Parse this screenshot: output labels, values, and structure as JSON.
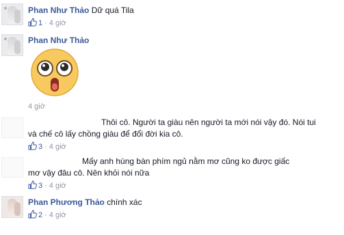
{
  "comments": [
    {
      "name": "Phan Như Thảo",
      "text": "Dữ quá Tila",
      "likes": "1",
      "time": "4 giờ"
    },
    {
      "name": "Phan Như Thảo",
      "sticker": "shocked-face-sticker",
      "time": "4 giờ"
    },
    {
      "lines": [
        "Thôi cô. Người ta giàu nên người ta mới nói vậy đó. Nói tui",
        "và chế cô lấy chồng giàu để đổi đời kia cô."
      ],
      "likes": "3",
      "time": "4 giờ"
    },
    {
      "lines": [
        "Mấy anh hùng bàn phím ngủ nằm mơ cũng ko được giấc",
        "mơ vậy đâu cô. Nên khỏi nói nữa"
      ],
      "likes": "3",
      "time": "4 giờ"
    },
    {
      "name": "Phan Phương Thảo",
      "text": "chính xác",
      "likes": "2",
      "time": "4 giờ"
    }
  ],
  "meta_separator": "·",
  "colors": {
    "name": "#3b5998",
    "meta": "#9197a3",
    "text": "#141823",
    "sticker_face": "#f7c95f"
  },
  "icons": {
    "like": "thumbs-up-icon"
  }
}
